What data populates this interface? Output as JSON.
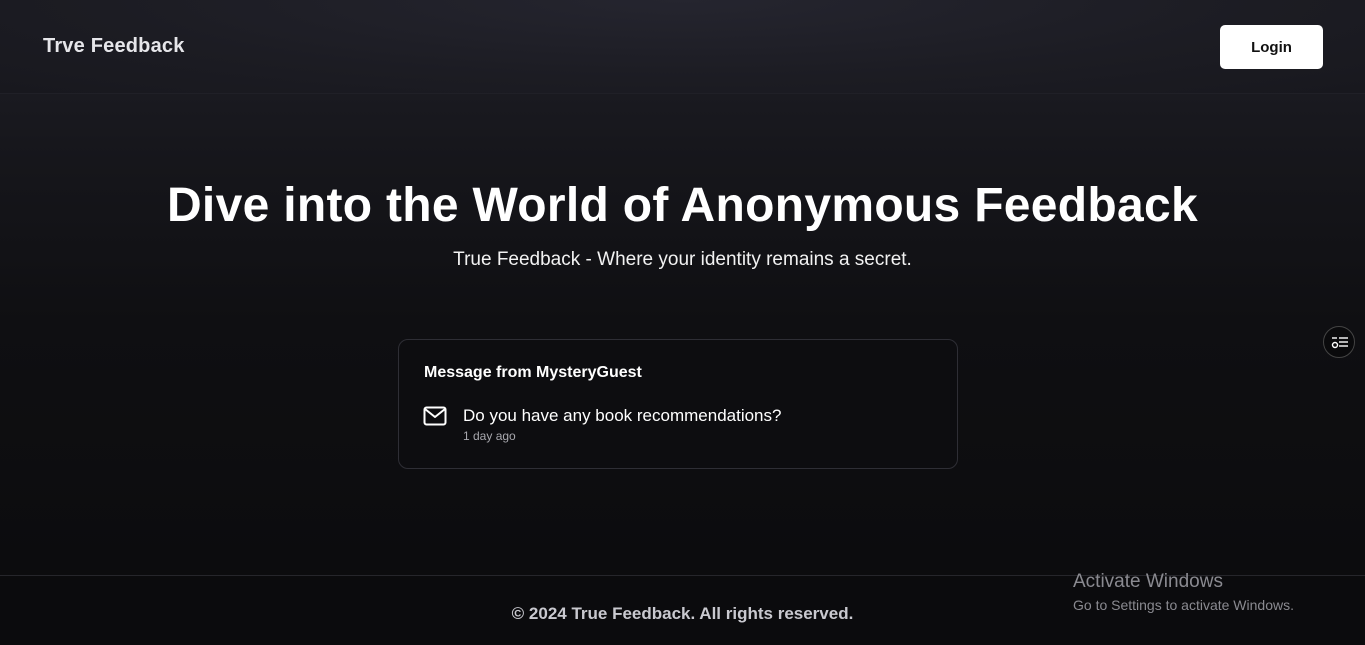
{
  "navbar": {
    "brand": "Trve Feedback",
    "login_label": "Login"
  },
  "hero": {
    "title": "Dive into the World of Anonymous Feedback",
    "subtitle": "True Feedback - Where your identity remains a secret."
  },
  "message_card": {
    "title": "Message from MysteryGuest",
    "icon": "mail-icon",
    "message": "Do you have any book recommendations?",
    "time": "1 day ago"
  },
  "side_widget": {
    "icon": "settings-list-icon"
  },
  "footer": {
    "copyright": "© 2024 True Feedback. All rights reserved."
  },
  "os_watermark": {
    "title": "Activate Windows",
    "subtitle": "Go to Settings to activate Windows."
  },
  "colors": {
    "background": "#0b0b0d",
    "navbar": "#1c1c23",
    "button_bg": "#ffffff",
    "text": "#ffffff",
    "muted": "#a8a8ae"
  }
}
